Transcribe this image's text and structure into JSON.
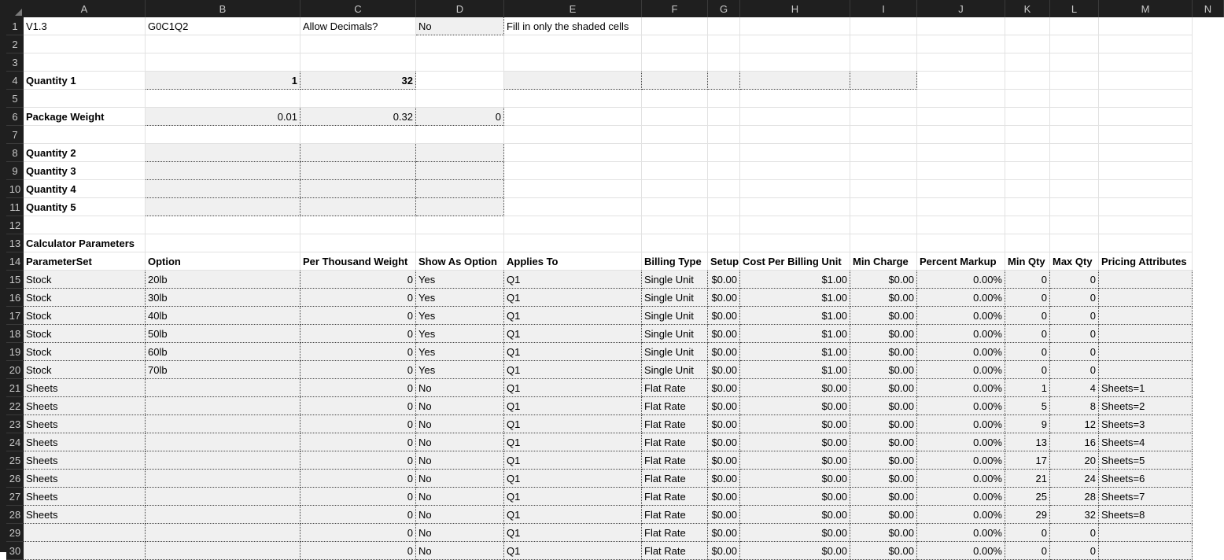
{
  "columns": [
    "A",
    "B",
    "C",
    "D",
    "E",
    "F",
    "G",
    "H",
    "I",
    "J",
    "K",
    "L",
    "M",
    "N"
  ],
  "rows": [
    "1",
    "2",
    "3",
    "4",
    "5",
    "6",
    "7",
    "8",
    "9",
    "10",
    "11",
    "12",
    "13",
    "14",
    "15",
    "16",
    "17",
    "18",
    "19",
    "20",
    "21",
    "22",
    "23",
    "24",
    "25",
    "26",
    "27",
    "28",
    "29",
    "30"
  ],
  "top": {
    "version": "V1.3",
    "code": "G0C1Q2",
    "allow_decimals_label": "Allow Decimals?",
    "allow_decimals_value": "No",
    "instruction": "Fill in only the shaded cells"
  },
  "quantity1": {
    "label": "Quantity 1",
    "b": "1",
    "c": "32"
  },
  "package_weight": {
    "label": "Package Weight",
    "b": "0.01",
    "c": "0.32",
    "d": "0"
  },
  "quantities": [
    "Quantity 2",
    "Quantity 3",
    "Quantity 4",
    "Quantity 5"
  ],
  "calc_title": "Calculator Parameters",
  "headers": [
    "ParameterSet",
    "Option",
    "Per Thousand Weight",
    "Show As Option",
    "Applies To",
    "Billing Type",
    "Setup",
    "Cost Per Billing Unit",
    "Min Charge",
    "Percent Markup",
    "Min Qty",
    "Max Qty",
    "Pricing Attributes"
  ],
  "table_rows": [
    [
      "Stock",
      "20lb",
      "0",
      "Yes",
      "Q1",
      "Single Unit",
      "$0.00",
      "$1.00",
      "$0.00",
      "0.00%",
      "0",
      "0",
      ""
    ],
    [
      "Stock",
      "30lb",
      "0",
      "Yes",
      "Q1",
      "Single Unit",
      "$0.00",
      "$1.00",
      "$0.00",
      "0.00%",
      "0",
      "0",
      ""
    ],
    [
      "Stock",
      "40lb",
      "0",
      "Yes",
      "Q1",
      "Single Unit",
      "$0.00",
      "$1.00",
      "$0.00",
      "0.00%",
      "0",
      "0",
      ""
    ],
    [
      "Stock",
      "50lb",
      "0",
      "Yes",
      "Q1",
      "Single Unit",
      "$0.00",
      "$1.00",
      "$0.00",
      "0.00%",
      "0",
      "0",
      ""
    ],
    [
      "Stock",
      "60lb",
      "0",
      "Yes",
      "Q1",
      "Single Unit",
      "$0.00",
      "$1.00",
      "$0.00",
      "0.00%",
      "0",
      "0",
      ""
    ],
    [
      "Stock",
      "70lb",
      "0",
      "Yes",
      "Q1",
      "Single Unit",
      "$0.00",
      "$1.00",
      "$0.00",
      "0.00%",
      "0",
      "0",
      ""
    ],
    [
      "Sheets",
      "",
      "0",
      "No",
      "Q1",
      "Flat Rate",
      "$0.00",
      "$0.00",
      "$0.00",
      "0.00%",
      "1",
      "4",
      "Sheets=1"
    ],
    [
      "Sheets",
      "",
      "0",
      "No",
      "Q1",
      "Flat Rate",
      "$0.00",
      "$0.00",
      "$0.00",
      "0.00%",
      "5",
      "8",
      "Sheets=2"
    ],
    [
      "Sheets",
      "",
      "0",
      "No",
      "Q1",
      "Flat Rate",
      "$0.00",
      "$0.00",
      "$0.00",
      "0.00%",
      "9",
      "12",
      "Sheets=3"
    ],
    [
      "Sheets",
      "",
      "0",
      "No",
      "Q1",
      "Flat Rate",
      "$0.00",
      "$0.00",
      "$0.00",
      "0.00%",
      "13",
      "16",
      "Sheets=4"
    ],
    [
      "Sheets",
      "",
      "0",
      "No",
      "Q1",
      "Flat Rate",
      "$0.00",
      "$0.00",
      "$0.00",
      "0.00%",
      "17",
      "20",
      "Sheets=5"
    ],
    [
      "Sheets",
      "",
      "0",
      "No",
      "Q1",
      "Flat Rate",
      "$0.00",
      "$0.00",
      "$0.00",
      "0.00%",
      "21",
      "24",
      "Sheets=6"
    ],
    [
      "Sheets",
      "",
      "0",
      "No",
      "Q1",
      "Flat Rate",
      "$0.00",
      "$0.00",
      "$0.00",
      "0.00%",
      "25",
      "28",
      "Sheets=7"
    ],
    [
      "Sheets",
      "",
      "0",
      "No",
      "Q1",
      "Flat Rate",
      "$0.00",
      "$0.00",
      "$0.00",
      "0.00%",
      "29",
      "32",
      "Sheets=8"
    ],
    [
      "",
      "",
      "0",
      "No",
      "Q1",
      "Flat Rate",
      "$0.00",
      "$0.00",
      "$0.00",
      "0.00%",
      "0",
      "0",
      ""
    ],
    [
      "",
      "",
      "0",
      "No",
      "Q1",
      "Flat Rate",
      "$0.00",
      "$0.00",
      "$0.00",
      "0.00%",
      "0",
      "0",
      ""
    ]
  ]
}
